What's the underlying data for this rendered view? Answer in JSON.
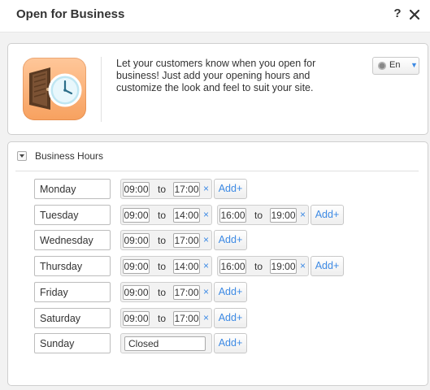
{
  "window": {
    "title": "Open for Business",
    "help_label": "?",
    "close_label": "X"
  },
  "intro": {
    "text": "Let your customers know when you open for business! Just add your opening hours and customize the look and feel to suit your site.",
    "language": "En"
  },
  "section": {
    "title": "Business Hours"
  },
  "labels": {
    "to": "to",
    "remove": "×",
    "add": "Add+"
  },
  "days": [
    {
      "name": "Monday",
      "slots": [
        {
          "open": "09:00",
          "close": "17:00"
        }
      ]
    },
    {
      "name": "Tuesday",
      "slots": [
        {
          "open": "09:00",
          "close": "14:00"
        },
        {
          "open": "16:00",
          "close": "19:00"
        }
      ]
    },
    {
      "name": "Wednesday",
      "slots": [
        {
          "open": "09:00",
          "close": "17:00"
        }
      ]
    },
    {
      "name": "Thursday",
      "slots": [
        {
          "open": "09:00",
          "close": "14:00"
        },
        {
          "open": "16:00",
          "close": "19:00"
        }
      ]
    },
    {
      "name": "Friday",
      "slots": [
        {
          "open": "09:00",
          "close": "17:00"
        }
      ]
    },
    {
      "name": "Saturday",
      "slots": [
        {
          "open": "09:00",
          "close": "17:00"
        }
      ]
    },
    {
      "name": "Sunday",
      "closed_value": "Closed",
      "slots": []
    }
  ],
  "colors": {
    "accent": "#3d8ae4",
    "icon_orange": "#f7a15f"
  }
}
